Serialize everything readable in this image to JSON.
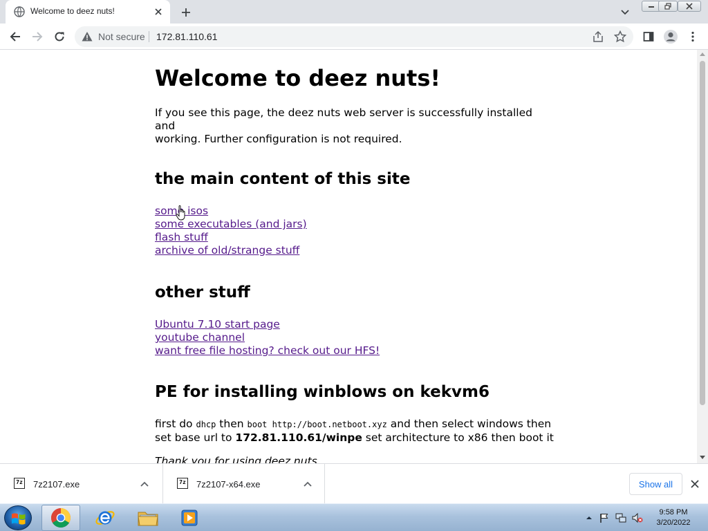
{
  "browser": {
    "tab_title": "Welcome to deez nuts!",
    "security_label": "Not secure",
    "url": "172.81.110.61"
  },
  "page": {
    "title": "Welcome to deez nuts!",
    "intro_line1": "If you see this page, the deez nuts web server is successfully installed and",
    "intro_line2": "working. Further configuration is not required.",
    "section1_heading": "the main content of this site",
    "section1_links": [
      "some isos",
      "some executables (and jars)",
      "flash stuff",
      "archive of old/strange stuff"
    ],
    "section2_heading": "other stuff",
    "section2_links": [
      "Ubuntu 7.10 start page",
      "youtube channel",
      "want free file hosting? check out our HFS!"
    ],
    "section3_heading": "PE for installing winblows on kekvm6",
    "pe": {
      "t1": "first do ",
      "c1": "dhcp",
      "t2": " then ",
      "c2": "boot http://boot.netboot.xyz",
      "t3": " and then select windows then",
      "t4": "set base url to ",
      "b1": "172.81.110.61/winpe",
      "t5": " set architecture to x86 then boot it"
    },
    "thanks": "Thank you for using deez nuts."
  },
  "downloads": {
    "items": [
      {
        "name": "7z2107.exe",
        "icon": "7z"
      },
      {
        "name": "7z2107-x64.exe",
        "icon": "7z"
      }
    ],
    "show_all_label": "Show all"
  },
  "taskbar": {
    "time": "9:58 PM",
    "date": "3/20/2022"
  },
  "colors": {
    "link": "#1a0dab",
    "visited_link": "#551a8b",
    "accent": "#1a73e8",
    "taskbar": "#a9c2dd"
  }
}
